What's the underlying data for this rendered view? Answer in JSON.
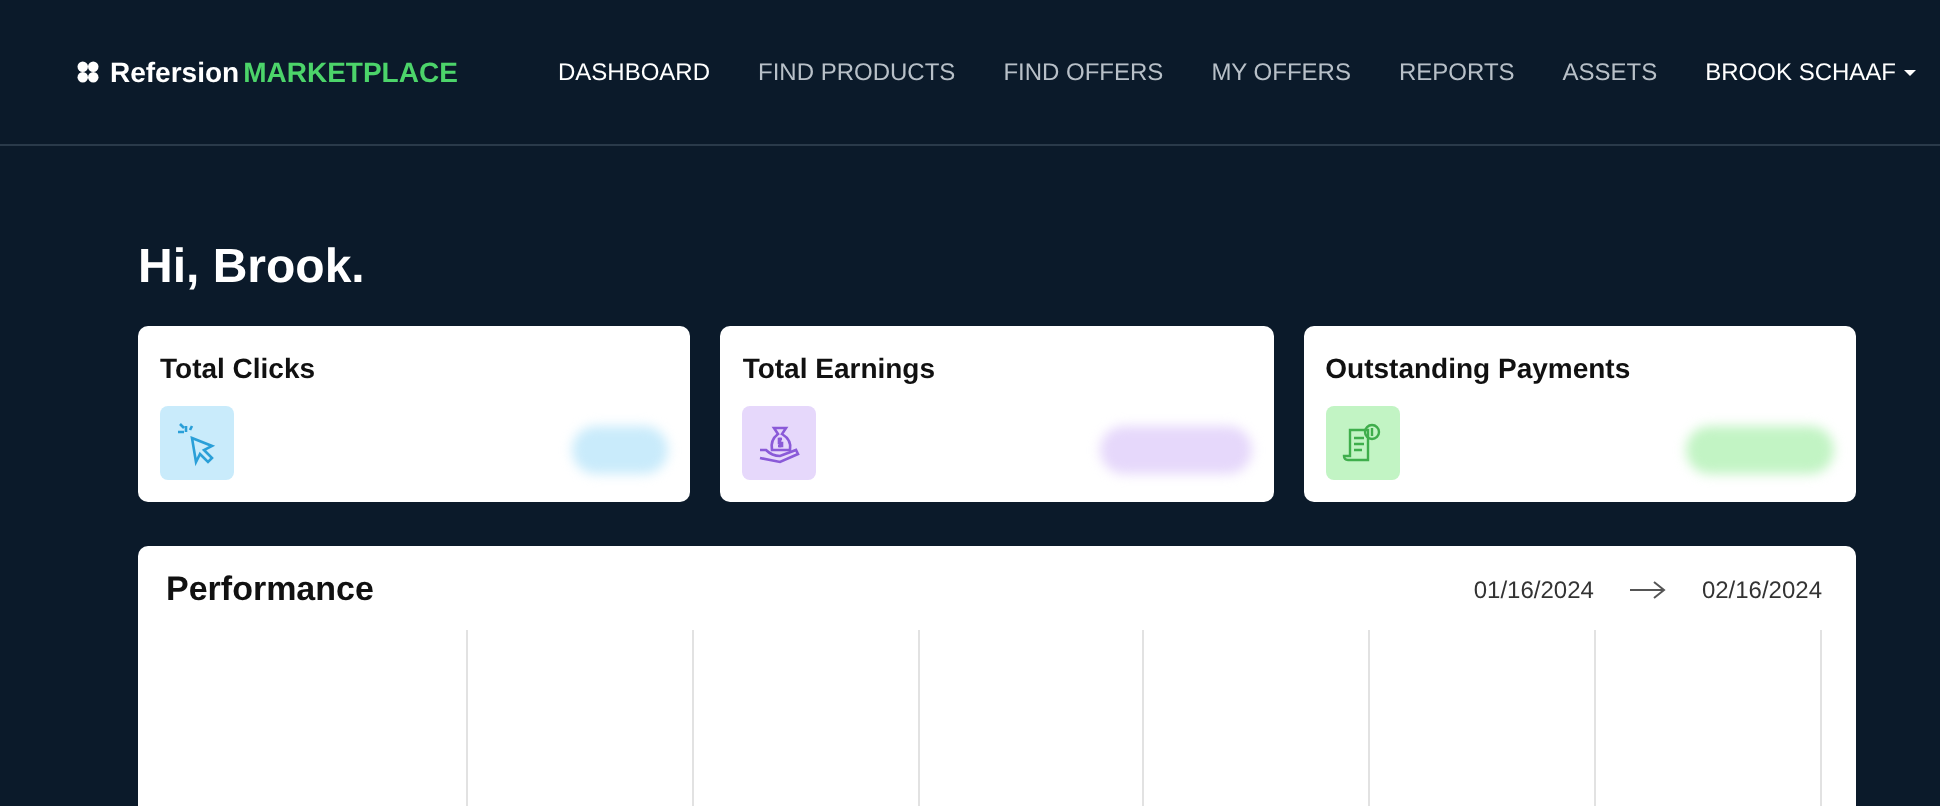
{
  "header": {
    "logo": {
      "brand": "Refersion",
      "product": "MARKETPLACE"
    },
    "nav": [
      {
        "label": "DASHBOARD",
        "selected": true
      },
      {
        "label": "FIND PRODUCTS",
        "selected": false
      },
      {
        "label": "FIND OFFERS",
        "selected": false
      },
      {
        "label": "MY OFFERS",
        "selected": false
      },
      {
        "label": "REPORTS",
        "selected": false
      },
      {
        "label": "ASSETS",
        "selected": false
      }
    ],
    "account": {
      "label": "BROOK SCHAAF"
    }
  },
  "greeting": "Hi, Brook.",
  "stats": [
    {
      "kind": "clicks",
      "title": "Total Clicks",
      "color": "#c9ebfb"
    },
    {
      "kind": "earnings",
      "title": "Total Earnings",
      "color": "#e6d8fb"
    },
    {
      "kind": "payments",
      "title": "Outstanding Payments",
      "color": "#c2f4c4"
    }
  ],
  "performance": {
    "title": "Performance",
    "date_from": "01/16/2024",
    "date_to": "02/16/2024"
  }
}
